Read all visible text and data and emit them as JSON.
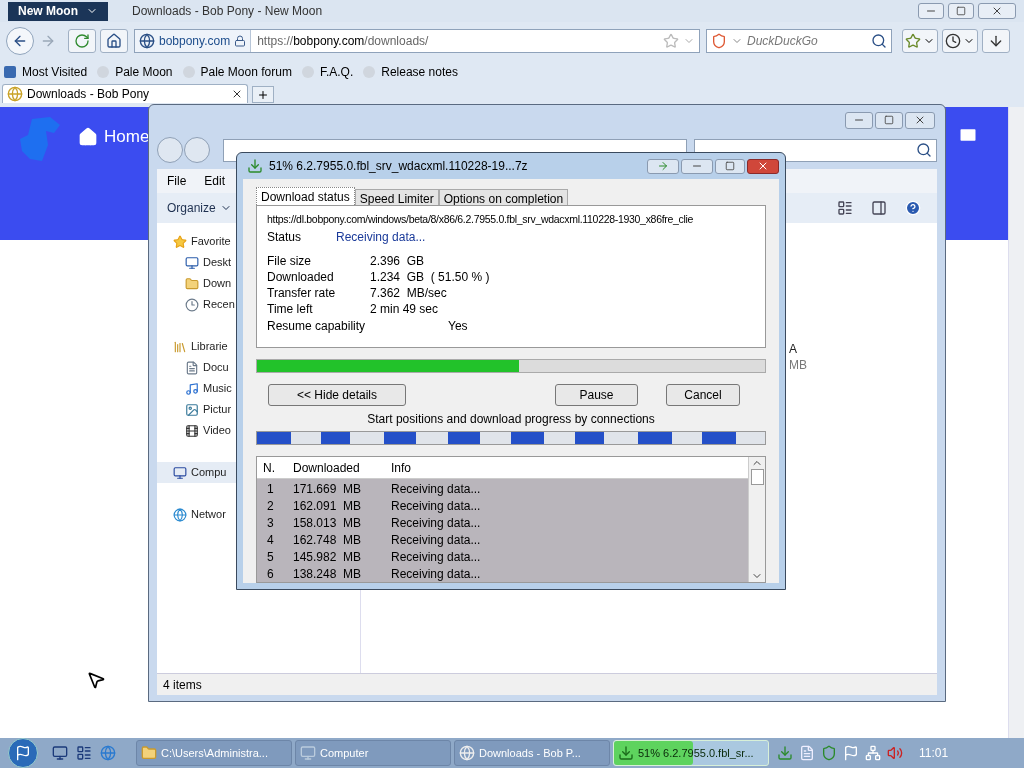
{
  "browser": {
    "app_button": "New Moon",
    "title": "Downloads - Bob Pony - New Moon",
    "identity": "bobpony.com",
    "url_scheme": "https://",
    "url_host": "bobpony.com",
    "url_path": "/downloads/",
    "search_placeholder": "DuckDuckGo",
    "bookmarks": [
      "Most Visited",
      "Pale Moon",
      "Pale Moon forum",
      "F.A.Q.",
      "Release notes"
    ],
    "tabs": [
      {
        "label": "Downloads - Bob Pony",
        "selected": true
      }
    ],
    "site_nav": "Home"
  },
  "explorer": {
    "menu": [
      "File",
      "Edit"
    ],
    "toolbar": "Organize",
    "nav": [
      {
        "label": "Favorite",
        "kind": "star",
        "selected": false,
        "children": [
          {
            "label": "Deskt",
            "kind": "desktop",
            "selected": false
          },
          {
            "label": "Down",
            "kind": "folder",
            "selected": false
          },
          {
            "label": "Recen",
            "kind": "recent",
            "selected": false
          }
        ]
      },
      {
        "label": "Librarie",
        "kind": "library",
        "selected": false,
        "children": [
          {
            "label": "Docu",
            "kind": "document",
            "selected": false
          },
          {
            "label": "Music",
            "kind": "music",
            "selected": false
          },
          {
            "label": "Pictur",
            "kind": "picture",
            "selected": false
          },
          {
            "label": "Video",
            "kind": "video",
            "selected": false
          }
        ]
      },
      {
        "label": "Compu",
        "kind": "computer",
        "selected": true
      },
      {
        "label": "Networ",
        "kind": "network",
        "selected": false
      }
    ],
    "fragments": [
      "A",
      "MB"
    ],
    "status": "4 items"
  },
  "dialog": {
    "title": "51% 6.2.7955.0.fbl_srv_wdacxml.110228-19...7z",
    "tabs": [
      {
        "label": "Download status",
        "selected": true
      },
      {
        "label": "Speed Limiter",
        "selected": false
      },
      {
        "label": "Options on completion",
        "selected": false
      }
    ],
    "url": "https://dl.bobpony.com/windows/beta/8/x86/6.2.7955.0.fbl_srv_wdacxml.110228-1930_x86fre_clie",
    "status_label": "Status",
    "status_value": "Receiving data...",
    "details": [
      {
        "label": "File size",
        "value": "2.396  GB"
      },
      {
        "label": "Downloaded",
        "value": "1.234  GB  ( 51.50 % )"
      },
      {
        "label": "Transfer rate",
        "value": "7.362  MB/sec"
      },
      {
        "label": "Time left",
        "value": "2 min 49 sec"
      }
    ],
    "resume_label": "Resume capability",
    "resume_value": "Yes",
    "level": 0.515,
    "hide_button": "<< Hide details",
    "pause_button": "Pause",
    "cancel_button": "Cancel",
    "connections_caption": "Start positions and download progress by connections",
    "connections": [
      {
        "level": 0.53
      },
      {
        "level": 0.47
      },
      {
        "level": 0.51
      },
      {
        "level": 0.51
      },
      {
        "level": 0.52
      },
      {
        "level": 0.46
      },
      {
        "level": 0.53
      },
      {
        "level": 0.54
      }
    ],
    "table": {
      "columns": [
        "N.",
        "Downloaded",
        "Info"
      ],
      "rows": [
        [
          "1",
          "171.669  MB",
          "Receiving data..."
        ],
        [
          "2",
          "162.091  MB",
          "Receiving data..."
        ],
        [
          "3",
          "158.013  MB",
          "Receiving data..."
        ],
        [
          "4",
          "162.748  MB",
          "Receiving data..."
        ],
        [
          "5",
          "145.982  MB",
          "Receiving data..."
        ],
        [
          "6",
          "138.248  MB",
          "Receiving data..."
        ]
      ]
    }
  },
  "taskbar": {
    "tasks": [
      {
        "label": "C:\\Users\\Administra...",
        "kind": "folder",
        "selected": false
      },
      {
        "label": "Computer",
        "kind": "computer",
        "selected": false
      },
      {
        "label": "Downloads - Bob P...",
        "kind": "browser",
        "selected": false
      },
      {
        "label": "51% 6.2.7955.0.fbl_sr...",
        "kind": "download",
        "selected": true,
        "level": 0.51
      }
    ],
    "clock": "11:01"
  }
}
